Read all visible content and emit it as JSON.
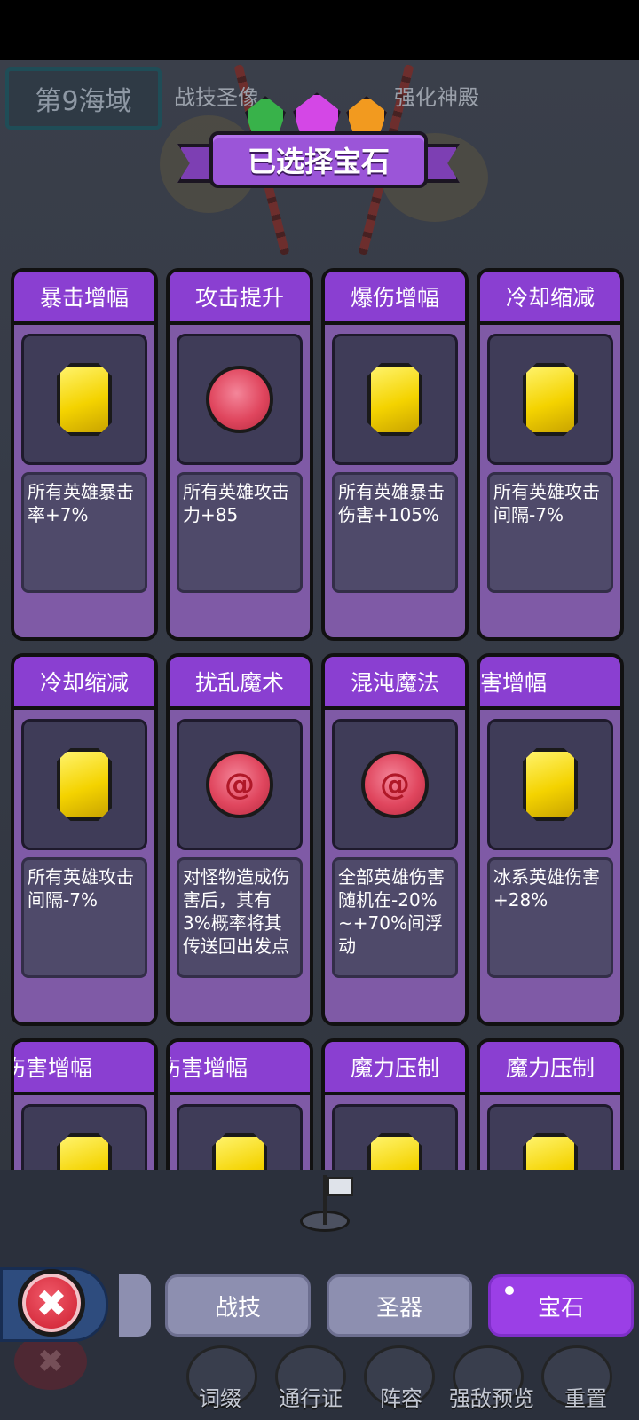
{
  "background": {
    "sea_label": "第9海域",
    "left_label": "战技圣像",
    "right_label": "强化神殿"
  },
  "banner": {
    "title": "已选择宝石"
  },
  "cards": [
    {
      "title": "暴击增幅",
      "gem": "yellow-gem",
      "desc": "所有英雄暴击率+7%"
    },
    {
      "title": "攻击提升",
      "gem": "red-gem",
      "desc": "所有英雄攻击力+85"
    },
    {
      "title": "爆伤增幅",
      "gem": "yellow-gem",
      "desc": "所有英雄暴击伤害+105%"
    },
    {
      "title": "冷却缩减",
      "gem": "yellow-gem",
      "desc": "所有英雄攻击间隔-7%"
    },
    {
      "title": "冷却缩减",
      "gem": "yellow-gem",
      "desc": "所有英雄攻击间隔-7%"
    },
    {
      "title": "扰乱魔术",
      "gem": "red-swirl-gem",
      "desc": "对怪物造成伤害后，其有3%概率将其传送回出发点"
    },
    {
      "title": "混沌魔法",
      "gem": "red-swirl-gem",
      "desc": "全部英雄伤害随机在-20%~+70%间浮动"
    },
    {
      "title": "害增幅",
      "gem": "yellow-gem",
      "desc": "冰系英雄伤害+28%"
    },
    {
      "title": "伤害增幅",
      "gem": "yellow-gem",
      "desc": ""
    },
    {
      "title": "伤害增幅",
      "gem": "yellow-gem",
      "desc": ""
    },
    {
      "title": "魔力压制",
      "gem": "yellow-gem",
      "desc": ""
    },
    {
      "title": "魔力压制",
      "gem": "yellow-gem",
      "desc": ""
    }
  ],
  "nav": {
    "close_symbol": "✖",
    "tabs": [
      {
        "label": "战技",
        "active": false
      },
      {
        "label": "圣器",
        "active": false
      },
      {
        "label": "宝石",
        "active": true
      }
    ]
  },
  "bottom_menu": [
    "词缀",
    "通行证",
    "阵容",
    "强敌预览",
    "重置"
  ],
  "colors": {
    "card_header": "#8a3fd1",
    "card_body": "#7f5aa6",
    "active_tab": "#9b3fe6",
    "inactive_tab": "#8d8fb0",
    "close_button": "#d52b3c"
  }
}
